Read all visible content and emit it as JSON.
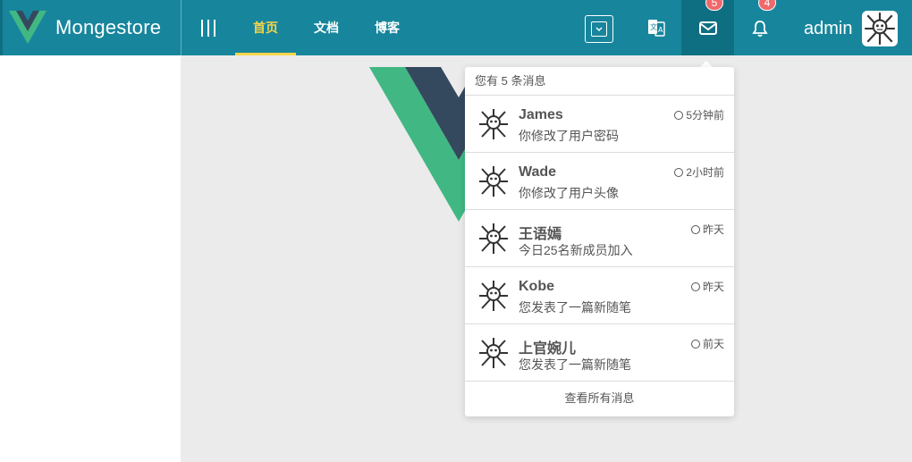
{
  "brand": {
    "name": "Mongestore"
  },
  "nav": {
    "items": [
      {
        "label": "首页",
        "active": true
      },
      {
        "label": "文档",
        "active": false
      },
      {
        "label": "博客",
        "active": false
      }
    ]
  },
  "header": {
    "mail_badge": "5",
    "bell_badge": "4",
    "username": "admin"
  },
  "messages": {
    "header": "您有 5 条消息",
    "items": [
      {
        "sender": "James",
        "text": "你修改了用户密码",
        "time": "5分钟前"
      },
      {
        "sender": "Wade",
        "text": "你修改了用户头像",
        "time": "2小时前"
      },
      {
        "sender": "王语嫣",
        "text": "今日25名新成员加入",
        "time": "昨天"
      },
      {
        "sender": "Kobe",
        "text": "您发表了一篇新随笔",
        "time": "昨天"
      },
      {
        "sender": "上官婉儿",
        "text": "您发表了一篇新随笔",
        "time": "前天"
      }
    ],
    "footer": "查看所有消息"
  },
  "colors": {
    "topbar": "#17869c",
    "active_nav": "#f7d54a",
    "badge": "#f0696a",
    "vue_green": "#41b883",
    "vue_dark": "#35495e"
  }
}
